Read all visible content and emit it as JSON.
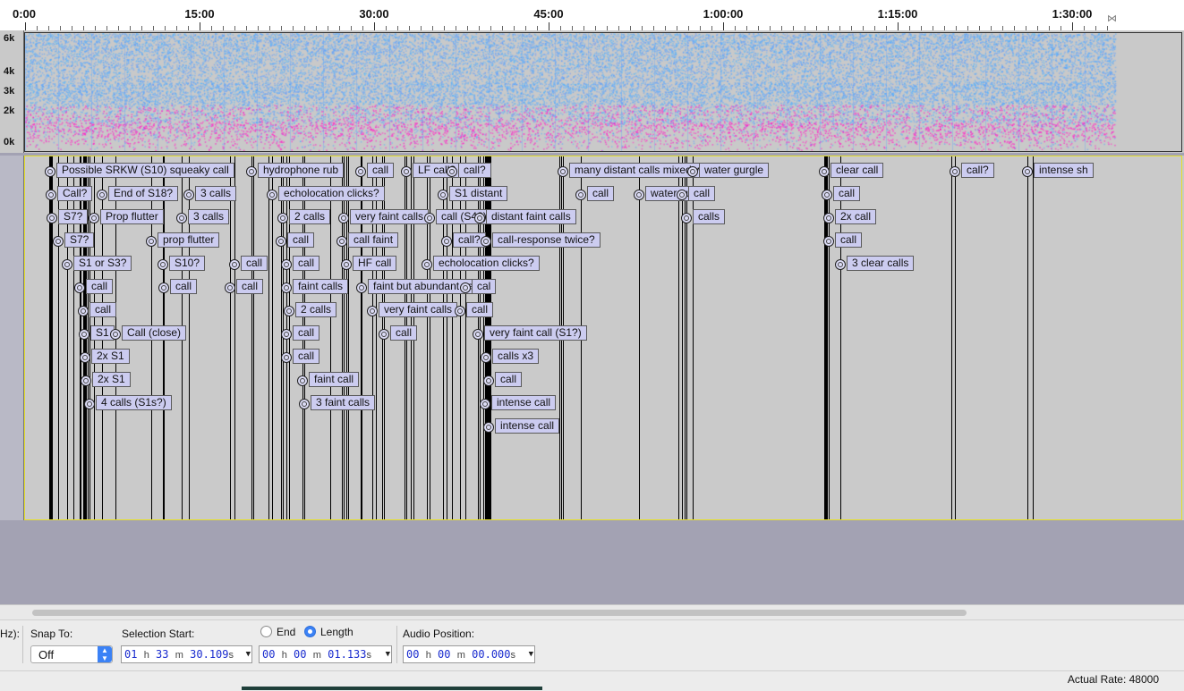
{
  "ruler": {
    "labels": [
      {
        "text": "0:00",
        "sec": 0
      },
      {
        "text": "15:00",
        "sec": 900
      },
      {
        "text": "30:00",
        "sec": 1800
      },
      {
        "text": "45:00",
        "sec": 2700
      },
      {
        "text": "1:00:00",
        "sec": 3600
      },
      {
        "text": "1:15:00",
        "sec": 4500
      },
      {
        "text": "1:30:00",
        "sec": 5400
      }
    ],
    "end_marker": "⋈"
  },
  "spectrogram": {
    "axis_labels": [
      "6k",
      "4k",
      "3k",
      "2k",
      "0k"
    ],
    "colors": {
      "background": "#c9c9c9",
      "low": "#55a0ff",
      "high": "#ff30c8"
    }
  },
  "labels": [
    {
      "text": "Possible SRKW (S10) squeaky call",
      "sec": 126,
      "row": 0
    },
    {
      "text": "Call?",
      "sec": 130,
      "row": 1
    },
    {
      "text": "S7?",
      "sec": 136,
      "row": 2
    },
    {
      "text": "S7?",
      "sec": 166,
      "row": 3
    },
    {
      "text": "S1 or S3?",
      "sec": 210,
      "row": 4
    },
    {
      "text": "call",
      "sec": 279,
      "row": 5
    },
    {
      "text": "call",
      "sec": 296,
      "row": 6
    },
    {
      "text": "S1",
      "sec": 300,
      "row": 7
    },
    {
      "text": "2x S1",
      "sec": 304,
      "row": 8
    },
    {
      "text": "2x S1",
      "sec": 308,
      "row": 9
    },
    {
      "text": "4 calls (S1s?)",
      "sec": 326,
      "row": 10
    },
    {
      "text": "End of S18?",
      "sec": 391,
      "row": 1
    },
    {
      "text": "Prop flutter",
      "sec": 353,
      "row": 2
    },
    {
      "text": "Call (close)",
      "sec": 462,
      "row": 7
    },
    {
      "text": "3 calls",
      "sec": 840,
      "row": 1
    },
    {
      "text": "3 calls",
      "sec": 803,
      "row": 2
    },
    {
      "text": "prop flutter",
      "sec": 648,
      "row": 3
    },
    {
      "text": "S10?",
      "sec": 706,
      "row": 4
    },
    {
      "text": "call",
      "sec": 711,
      "row": 5
    },
    {
      "text": "call",
      "sec": 1075,
      "row": 4
    },
    {
      "text": "call",
      "sec": 1052,
      "row": 5
    },
    {
      "text": "hydrophone rub",
      "sec": 1163,
      "row": 0
    },
    {
      "text": "echolocation clicks?",
      "sec": 1270,
      "row": 1
    },
    {
      "text": "2 calls",
      "sec": 1323,
      "row": 2
    },
    {
      "text": "call",
      "sec": 1315,
      "row": 3
    },
    {
      "text": "call",
      "sec": 1342,
      "row": 4
    },
    {
      "text": "faint calls",
      "sec": 1342,
      "row": 5
    },
    {
      "text": "2 calls",
      "sec": 1356,
      "row": 6
    },
    {
      "text": "call",
      "sec": 1344,
      "row": 7
    },
    {
      "text": "call",
      "sec": 1342,
      "row": 8
    },
    {
      "text": "faint call",
      "sec": 1428,
      "row": 9
    },
    {
      "text": "3 faint calls",
      "sec": 1436,
      "row": 10
    },
    {
      "text": "call",
      "sec": 1725,
      "row": 0
    },
    {
      "text": "very faint calls",
      "sec": 1639,
      "row": 2
    },
    {
      "text": "call faint",
      "sec": 1631,
      "row": 3
    },
    {
      "text": "HF call",
      "sec": 1650,
      "row": 4
    },
    {
      "text": "faint but abundant calls",
      "sec": 1731,
      "row": 5
    },
    {
      "text": "very faint calls",
      "sec": 1785,
      "row": 6
    },
    {
      "text": "call",
      "sec": 1845,
      "row": 7
    },
    {
      "text": "LF call?",
      "sec": 1961,
      "row": 0
    },
    {
      "text": "echolocation clicks?",
      "sec": 2066,
      "row": 4
    },
    {
      "text": "call (S4?)",
      "sec": 2082,
      "row": 2
    },
    {
      "text": "S1 distant",
      "sec": 2152,
      "row": 1
    },
    {
      "text": "call?",
      "sec": 2195,
      "row": 0
    },
    {
      "text": "call?",
      "sec": 2170,
      "row": 3
    },
    {
      "text": "call",
      "sec": 2239,
      "row": 6
    },
    {
      "text": "distant faint calls",
      "sec": 2342,
      "row": 2
    },
    {
      "text": "call-response twice?",
      "sec": 2372,
      "row": 3
    },
    {
      "text": "cal",
      "sec": 2266,
      "row": 5
    },
    {
      "text": "very faint call (S1?)",
      "sec": 2333,
      "row": 7
    },
    {
      "text": "calls x3",
      "sec": 2372,
      "row": 8
    },
    {
      "text": "call",
      "sec": 2387,
      "row": 9
    },
    {
      "text": "intense call",
      "sec": 2368,
      "row": 10
    },
    {
      "text": "intense call",
      "sec": 2384,
      "row": 11
    },
    {
      "text": "many distant calls mixed w/gurgling",
      "sec": 2770,
      "row": 0
    },
    {
      "text": "call",
      "sec": 2863,
      "row": 1
    },
    {
      "text": "water gurgle",
      "sec": 3160,
      "row": 1
    },
    {
      "text": "water gurgle",
      "sec": 3440,
      "row": 0
    },
    {
      "text": "call",
      "sec": 3382,
      "row": 1
    },
    {
      "text": "calls",
      "sec": 3407,
      "row": 2
    },
    {
      "text": "clear call",
      "sec": 4115,
      "row": 0
    },
    {
      "text": "call",
      "sec": 4132,
      "row": 1
    },
    {
      "text": "2x call",
      "sec": 4138,
      "row": 2
    },
    {
      "text": "call",
      "sec": 4141,
      "row": 3
    },
    {
      "text": "3 clear calls",
      "sec": 4198,
      "row": 4
    },
    {
      "text": "call?",
      "sec": 4790,
      "row": 0
    },
    {
      "text": "intense sh",
      "sec": 5165,
      "row": 0
    }
  ],
  "toolbar": {
    "rate_label_tail": "Hz):",
    "snap_to_label": "Snap To:",
    "snap_value": "Off",
    "selection_start_label": "Selection Start:",
    "end_label": "End",
    "length_label": "Length",
    "audio_position_label": "Audio Position:",
    "selection_start": {
      "h": "01",
      "m": "33",
      "s": "30.109"
    },
    "length": {
      "h": "00",
      "m": "00",
      "s": "01.133"
    },
    "audio_position": {
      "h": "00",
      "m": "00",
      "s": "00.000"
    },
    "units": {
      "h": "h",
      "m": "m",
      "s": "s"
    },
    "length_selected": true
  },
  "status": {
    "actual_rate": "Actual Rate: 48000"
  },
  "colors": {
    "label_fill": "#ccccf0",
    "track_border": "#e6df2a",
    "radio_on": "#3b82f6"
  }
}
